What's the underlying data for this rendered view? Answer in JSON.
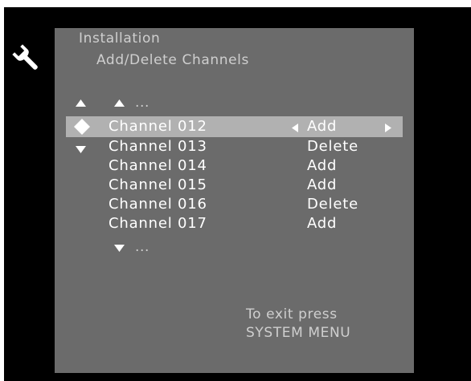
{
  "header": {
    "section_title": "Installation",
    "subtitle": "Add/Delete Channels"
  },
  "list": {
    "scroll_up_more": "...",
    "scroll_down_more": "...",
    "rows": [
      {
        "channel": "Channel 012",
        "action": "Add",
        "selected": true
      },
      {
        "channel": "Channel 013",
        "action": "Delete",
        "selected": false
      },
      {
        "channel": "Channel 014",
        "action": "Add",
        "selected": false
      },
      {
        "channel": "Channel 015",
        "action": "Add",
        "selected": false
      },
      {
        "channel": "Channel 016",
        "action": "Delete",
        "selected": false
      },
      {
        "channel": "Channel 017",
        "action": "Add",
        "selected": false
      }
    ]
  },
  "footer": {
    "exit_line1": "To exit press",
    "exit_line2": "SYSTEM MENU"
  },
  "icons": {
    "menu_icon": "wrench-icon",
    "nav_up": "triangle-up-icon",
    "nav_down": "triangle-down-icon",
    "selector": "four-way-diamond-icon",
    "value_left": "triangle-left-icon",
    "value_right": "triangle-right-icon"
  },
  "colors": {
    "screen_bg": "#000000",
    "panel_bg": "#6b6b6b",
    "highlight_bg": "#b1b1b1",
    "text_primary": "#ffffff",
    "text_secondary": "#cfcfcf"
  }
}
